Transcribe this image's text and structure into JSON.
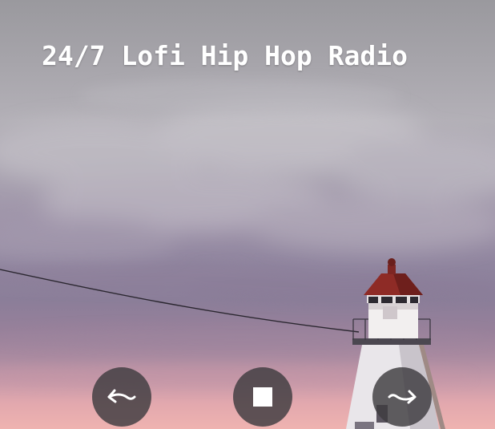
{
  "player": {
    "title": "24/7 Lofi Hip Hop Radio"
  },
  "controls": {
    "previous_icon": "curly-arrow-left-icon",
    "stop_icon": "stop-icon",
    "next_icon": "curly-arrow-right-icon"
  },
  "colors": {
    "title_text": "#ffffff",
    "button_background": "#3e3c40",
    "button_icon": "#ffffff",
    "lighthouse_roof": "#8e2b26"
  }
}
